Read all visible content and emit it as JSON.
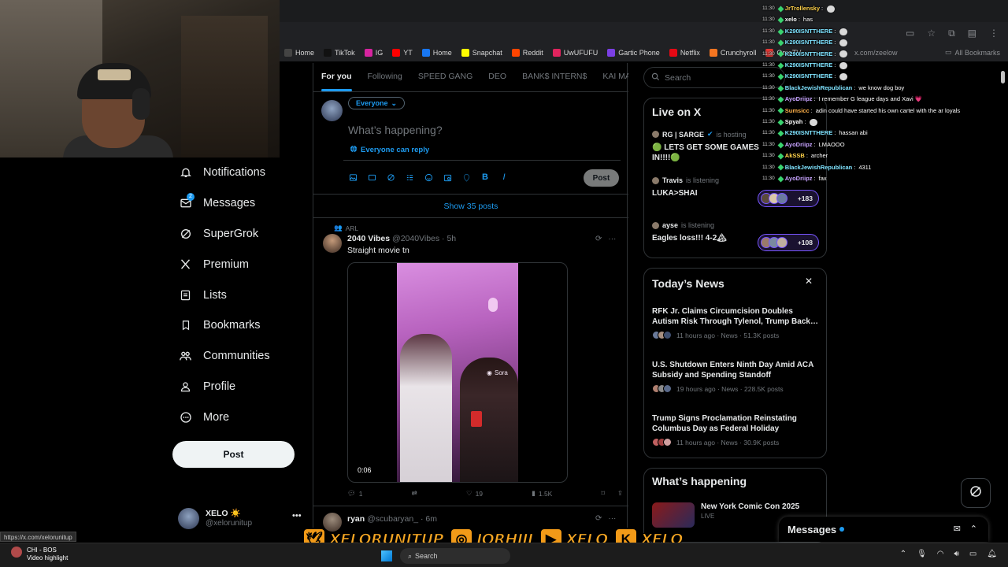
{
  "browser": {
    "url_fragment": "x.com/zeelow",
    "all_bookmarks": "All Bookmarks",
    "bookmarks": [
      {
        "label": "Home",
        "color": "#444"
      },
      {
        "label": "TikTok",
        "color": "#111"
      },
      {
        "label": "IG",
        "color": "#d6249f"
      },
      {
        "label": "YT",
        "color": "#ff0000"
      },
      {
        "label": "Home",
        "color": "#1877f2"
      },
      {
        "label": "Snapchat",
        "color": "#fffc00"
      },
      {
        "label": "Reddit",
        "color": "#ff4500"
      },
      {
        "label": "UwUFUFU",
        "color": "#e0245e"
      },
      {
        "label": "Gartic Phone",
        "color": "#7b3fe4"
      },
      {
        "label": "Netflix",
        "color": "#e50914"
      },
      {
        "label": "Crunchyroll",
        "color": "#f47521"
      },
      {
        "label": "OmeTV",
        "color": "#e53935"
      }
    ]
  },
  "nav": {
    "items": [
      {
        "label": "Notifications",
        "icon": "bell-icon"
      },
      {
        "label": "Messages",
        "icon": "envelope-icon",
        "badge": "2"
      },
      {
        "label": "SuperGrok",
        "icon": "grok-icon"
      },
      {
        "label": "Premium",
        "icon": "x-logo-icon"
      },
      {
        "label": "Lists",
        "icon": "list-icon"
      },
      {
        "label": "Bookmarks",
        "icon": "bookmark-icon"
      },
      {
        "label": "Communities",
        "icon": "communities-icon"
      },
      {
        "label": "Profile",
        "icon": "person-icon"
      },
      {
        "label": "More",
        "icon": "more-circle-icon"
      }
    ],
    "post_label": "Post"
  },
  "account": {
    "name": "XELO ☀️",
    "handle": "@xelorunitup",
    "more": "•••"
  },
  "status_url": "https://x.com/xelorunitup",
  "feed": {
    "tabs": [
      "For you",
      "Following",
      "SPEED GANG",
      "DEO",
      "BANK$ INTERN$",
      "KAI MAF"
    ],
    "composer": {
      "audience": "Everyone",
      "placeholder": "What’s happening?",
      "reply_setting": "Everyone can reply",
      "post_label": "Post"
    },
    "show_posts": "Show 35 posts",
    "tweet1": {
      "repost_by": "ARL",
      "name": "2040 Vibes",
      "handle": "@2040Vibes",
      "time": "5h",
      "text": "Straight movie tn",
      "video_time": "0:06",
      "watermark": "Sora",
      "replies": "1",
      "likes": "19",
      "views": "1.5K"
    },
    "tweet2": {
      "name": "ryan",
      "handle": "@scubaryan_",
      "time": "6m"
    }
  },
  "right": {
    "search_placeholder": "Search",
    "live": {
      "title": "Live on X",
      "spaces": [
        {
          "host": "RG | SARGE",
          "status": "is hosting",
          "title": "🟢 LETS GET SOME GAMES IN!!!!🟢",
          "count": ""
        },
        {
          "host": "Travis",
          "status": "is listening",
          "title": "LUKA>SHAI",
          "count": "+183"
        },
        {
          "host": "ayse",
          "status": "is listening",
          "title": "Eagles loss!!! 4-2🏔",
          "count": "+108"
        }
      ]
    },
    "news": {
      "title": "Today’s News",
      "items": [
        {
          "title": "RFK Jr. Claims Circumcision Doubles Autism Risk Through Tylenol, Trump Back…",
          "meta": "11 hours ago · News · 51.3K posts"
        },
        {
          "title": "U.S. Shutdown Enters Ninth Day Amid ACA Subsidy and Spending Standoff",
          "meta": "19 hours ago · News · 228.5K posts"
        },
        {
          "title": "Trump Signs Proclamation Reinstating Columbus Day as Federal Holiday",
          "meta": "11 hours ago · News · 30.9K posts"
        }
      ]
    },
    "happening": {
      "title": "What’s happening",
      "item_title": "New York Comic Con 2025",
      "item_sub": "LIVE"
    }
  },
  "messages_drawer": {
    "title": "Messages"
  },
  "chat": [
    {
      "time": "11:30",
      "user": "JrTrollensky",
      "color": "#ffd24a",
      "msg": "",
      "emote": true
    },
    {
      "time": "11:30",
      "user": "xelo",
      "color": "#ffffff",
      "msg": "has",
      "emote": false
    },
    {
      "time": "11:30",
      "user": "K290ISNTTHERE",
      "color": "#7fe3ff",
      "msg": "",
      "emote": true
    },
    {
      "time": "11:30",
      "user": "K290ISNTTHERE",
      "color": "#7fe3ff",
      "msg": "",
      "emote": true
    },
    {
      "time": "11:30",
      "user": "K290ISNTTHERE",
      "color": "#7fe3ff",
      "msg": "",
      "emote": true
    },
    {
      "time": "11:30",
      "user": "K290ISNTTHERE",
      "color": "#7fe3ff",
      "msg": "",
      "emote": true
    },
    {
      "time": "11:30",
      "user": "K290ISNTTHERE",
      "color": "#7fe3ff",
      "msg": "",
      "emote": true
    },
    {
      "time": "11:30",
      "user": "BlackJewishRepublican",
      "color": "#7fe3ff",
      "msg": "we know dog boy",
      "emote": false
    },
    {
      "time": "11:30",
      "user": "AyoDriipz",
      "color": "#c7a3ff",
      "msg": "I remember G league days and Xavi 💗",
      "emote": false
    },
    {
      "time": "11:30",
      "user": "Sumsicc",
      "color": "#ffb14a",
      "msg": "adin could have started his own cartel with the ar loyals",
      "emote": false
    },
    {
      "time": "11:30",
      "user": "Spyah",
      "color": "#ffffff",
      "msg": "",
      "emote": true
    },
    {
      "time": "11:30",
      "user": "K290ISNTTHERE",
      "color": "#7fe3ff",
      "msg": "hassan abi",
      "emote": false
    },
    {
      "time": "11:30",
      "user": "AyoDriipz",
      "color": "#c7a3ff",
      "msg": "LMAOOO",
      "emote": false
    },
    {
      "time": "11:30",
      "user": "AkSSB",
      "color": "#ffd24a",
      "msg": "archer",
      "emote": false
    },
    {
      "time": "11:30",
      "user": "BlackJewishRepublican",
      "color": "#7fe3ff",
      "msg": "4311",
      "emote": false
    },
    {
      "time": "11:30",
      "user": "AyoDriipz",
      "color": "#c7a3ff",
      "msg": "fax",
      "emote": false
    }
  ],
  "overlay": {
    "socials": [
      {
        "icon": "twitter-bird-icon",
        "handle": "XELORUNITUP"
      },
      {
        "icon": "instagram-icon",
        "handle": "JORHIII"
      },
      {
        "icon": "youtube-play-icon",
        "handle": "XELO"
      },
      {
        "icon": "kick-k-icon",
        "handle": "XELO"
      }
    ],
    "accent": "#f5a623"
  },
  "taskbar": {
    "game_title": "CHI - BOS",
    "game_sub": "Video highlight",
    "search": "Search"
  }
}
